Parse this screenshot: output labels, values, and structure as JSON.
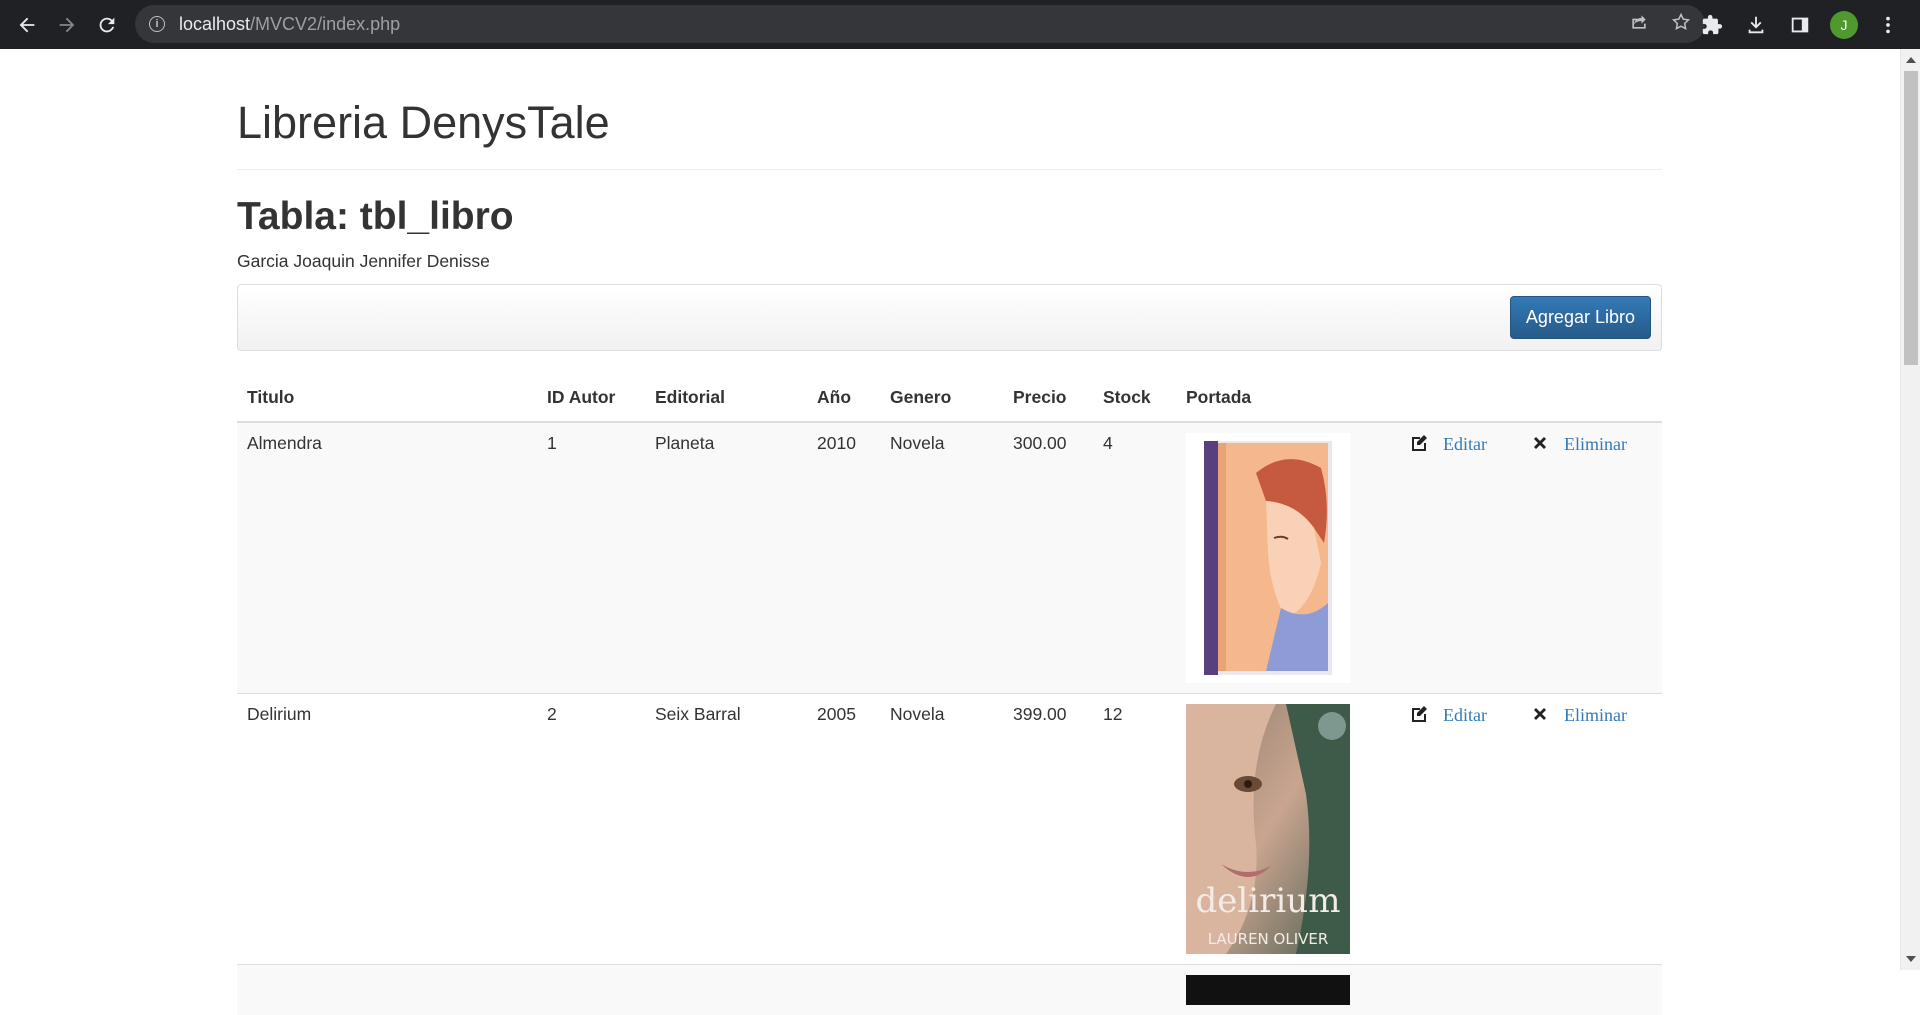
{
  "browser": {
    "url_host": "localhost",
    "url_path": "/MVCV2/index.php",
    "profile_initial": "J"
  },
  "page": {
    "brand": "Libreria DenysTale",
    "table_title": "Tabla: tbl_libro",
    "author": "Garcia Joaquin Jennifer Denisse",
    "add_button": "Agregar Libro"
  },
  "table": {
    "headers": [
      "Titulo",
      "ID Autor",
      "Editorial",
      "Año",
      "Genero",
      "Precio",
      "Stock",
      "Portada"
    ],
    "rows": [
      {
        "titulo": "Almendra",
        "id_autor": "1",
        "editorial": "Planeta",
        "anio": "2010",
        "genero": "Novela",
        "precio": "300.00",
        "stock": "4",
        "edit_label": "Editar",
        "delete_label": "Eliminar"
      },
      {
        "titulo": "Delirium",
        "id_autor": "2",
        "editorial": "Seix Barral",
        "anio": "2005",
        "genero": "Novela",
        "precio": "399.00",
        "stock": "12",
        "cover_title": "delirium",
        "cover_author": "LAUREN OLIVER",
        "edit_label": "Editar",
        "delete_label": "Eliminar"
      }
    ]
  },
  "colors": {
    "link": "#337ab7",
    "button": "#2d6ca2",
    "chrome": "#202124"
  }
}
